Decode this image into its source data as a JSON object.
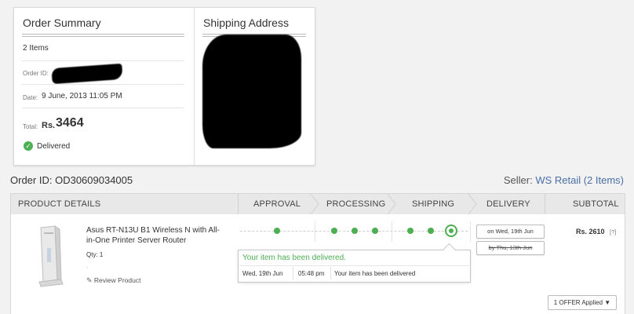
{
  "summary": {
    "title": "Order Summary",
    "items": "2 Items",
    "order_id_label": "Order ID:",
    "date_label": "Date:",
    "date_value": "9 June, 2013 11:05 PM",
    "total_label": "Total:",
    "total_currency": "Rs.",
    "total_value": "3464",
    "status": "Delivered"
  },
  "shipping": {
    "title": "Shipping Address"
  },
  "order": {
    "id_label": "Order ID:",
    "id_value": "OD30609034005",
    "seller_label": "Seller:",
    "seller_value": "WS Retail (2 Items)"
  },
  "columns": {
    "product": "PRODUCT DETAILS",
    "approval": "APPROVAL",
    "processing": "PROCESSING",
    "shipping": "SHIPPING",
    "delivery": "DELIVERY",
    "subtotal": "SUBTOTAL"
  },
  "product": {
    "name": "Asus RT-N13U B1 Wireless N with All-in-One Printer Server Router",
    "qty": "Qty: 1",
    "review": "Review Product",
    "price": "Rs. 2610",
    "price_help": "[?]"
  },
  "tracking": {
    "message": "Your item has been delivered.",
    "event_date": "Wed, 19th Jun",
    "event_time": "05:48 pm",
    "event_text": "Your item has been delivered",
    "delivered_on": "on Wed, 19th Jun",
    "expected_by": "by Thu, 13th Jun"
  },
  "offer": {
    "label": "1 OFFER Applied ▼"
  },
  "colors": {
    "accent_green": "#4caf50",
    "link_blue": "#4a6fa5"
  }
}
